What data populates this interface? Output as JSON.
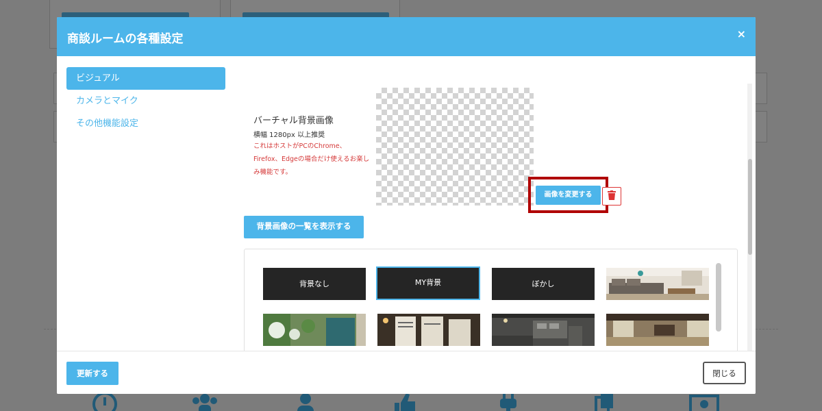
{
  "modal": {
    "title": "商談ルームの各種設定",
    "close_label": "×"
  },
  "sidebar": {
    "items": [
      {
        "label": "ビジュアル",
        "active": true
      },
      {
        "label": "カメラとマイク",
        "active": false
      },
      {
        "label": "その他機能設定",
        "active": false
      }
    ]
  },
  "visual": {
    "title": "バーチャル背景画像",
    "subtitle": "横幅 1280px 以上推奨",
    "note": "これはホストがPCのChrome、Firefox、Edgeの場合だけ使えるお楽しみ機能です。",
    "change_button": "画像を変更する",
    "delete_icon": "trash-icon",
    "list_button": "背景画像の一覧を表示する"
  },
  "gallery": {
    "text_tiles": [
      {
        "label": "背景なし",
        "selected": false
      },
      {
        "label": "MY背景",
        "selected": true
      },
      {
        "label": "ぼかし",
        "selected": false
      }
    ]
  },
  "footer": {
    "update_button": "更新する",
    "close_button": "閉じる"
  },
  "colors": {
    "accent": "#4cb5ea",
    "danger": "#d53a3a",
    "highlight": "#b00000"
  }
}
